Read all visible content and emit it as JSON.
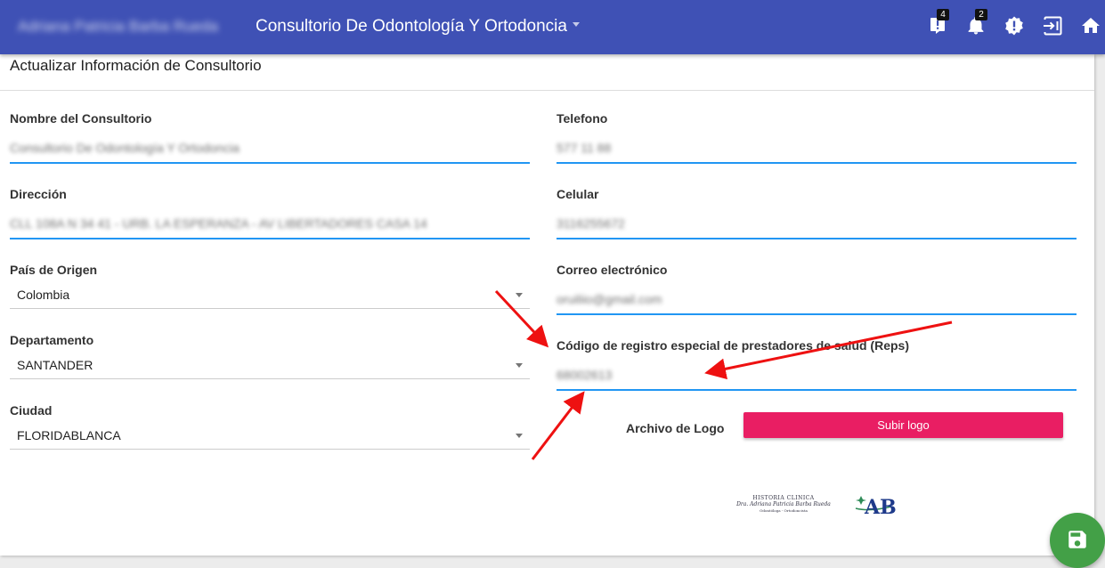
{
  "header": {
    "user_name": "Adriana Patricia Barba Rueda",
    "office_title": "Consultorio De Odontología Y Ortodoncia",
    "icons": [
      {
        "name": "tasks-icon",
        "badge": "4"
      },
      {
        "name": "bell-icon",
        "badge": "2"
      },
      {
        "name": "alert-icon"
      },
      {
        "name": "logout-icon"
      },
      {
        "name": "home-icon"
      }
    ]
  },
  "form": {
    "title": "Actualizar Información de Consultorio",
    "nombre": {
      "label": "Nombre del Consultorio",
      "value": "Consultorio De Odontología Y Ortodoncia"
    },
    "direccion": {
      "label": "Dirección",
      "value": "CLL 108A N 34 41 - URB. LA ESPERANZA - AV LIBERTADORES CASA 14"
    },
    "pais": {
      "label": "País de Origen",
      "value": "Colombia"
    },
    "departamento": {
      "label": "Departamento",
      "value": "SANTANDER"
    },
    "ciudad": {
      "label": "Ciudad",
      "value": "FLORIDABLANCA"
    },
    "telefono": {
      "label": "Telefono",
      "value": "577 11 88"
    },
    "celular": {
      "label": "Celular",
      "value": "3116255672"
    },
    "correo": {
      "label": "Correo electrónico",
      "value": "oruiliio@gmail.com"
    },
    "reps": {
      "label": "Código de registro especial de prestadores de salud (Reps)",
      "value": "68002613"
    },
    "logo": {
      "label": "Archivo de Logo",
      "button": "Subir logo"
    },
    "logo_preview": {
      "line1": "HISTORIA CLINICA",
      "line2": "Dra. Adriana Patricia Barba Rueda",
      "line3": "Odontóloga - Ortodoncista",
      "mark": "AB"
    }
  },
  "colors": {
    "header": "#3f51b5",
    "accent_field": "#2196f3",
    "upload_button": "#e91e63",
    "save_fab": "#43a047",
    "annotation_arrows": "#ee1111"
  }
}
